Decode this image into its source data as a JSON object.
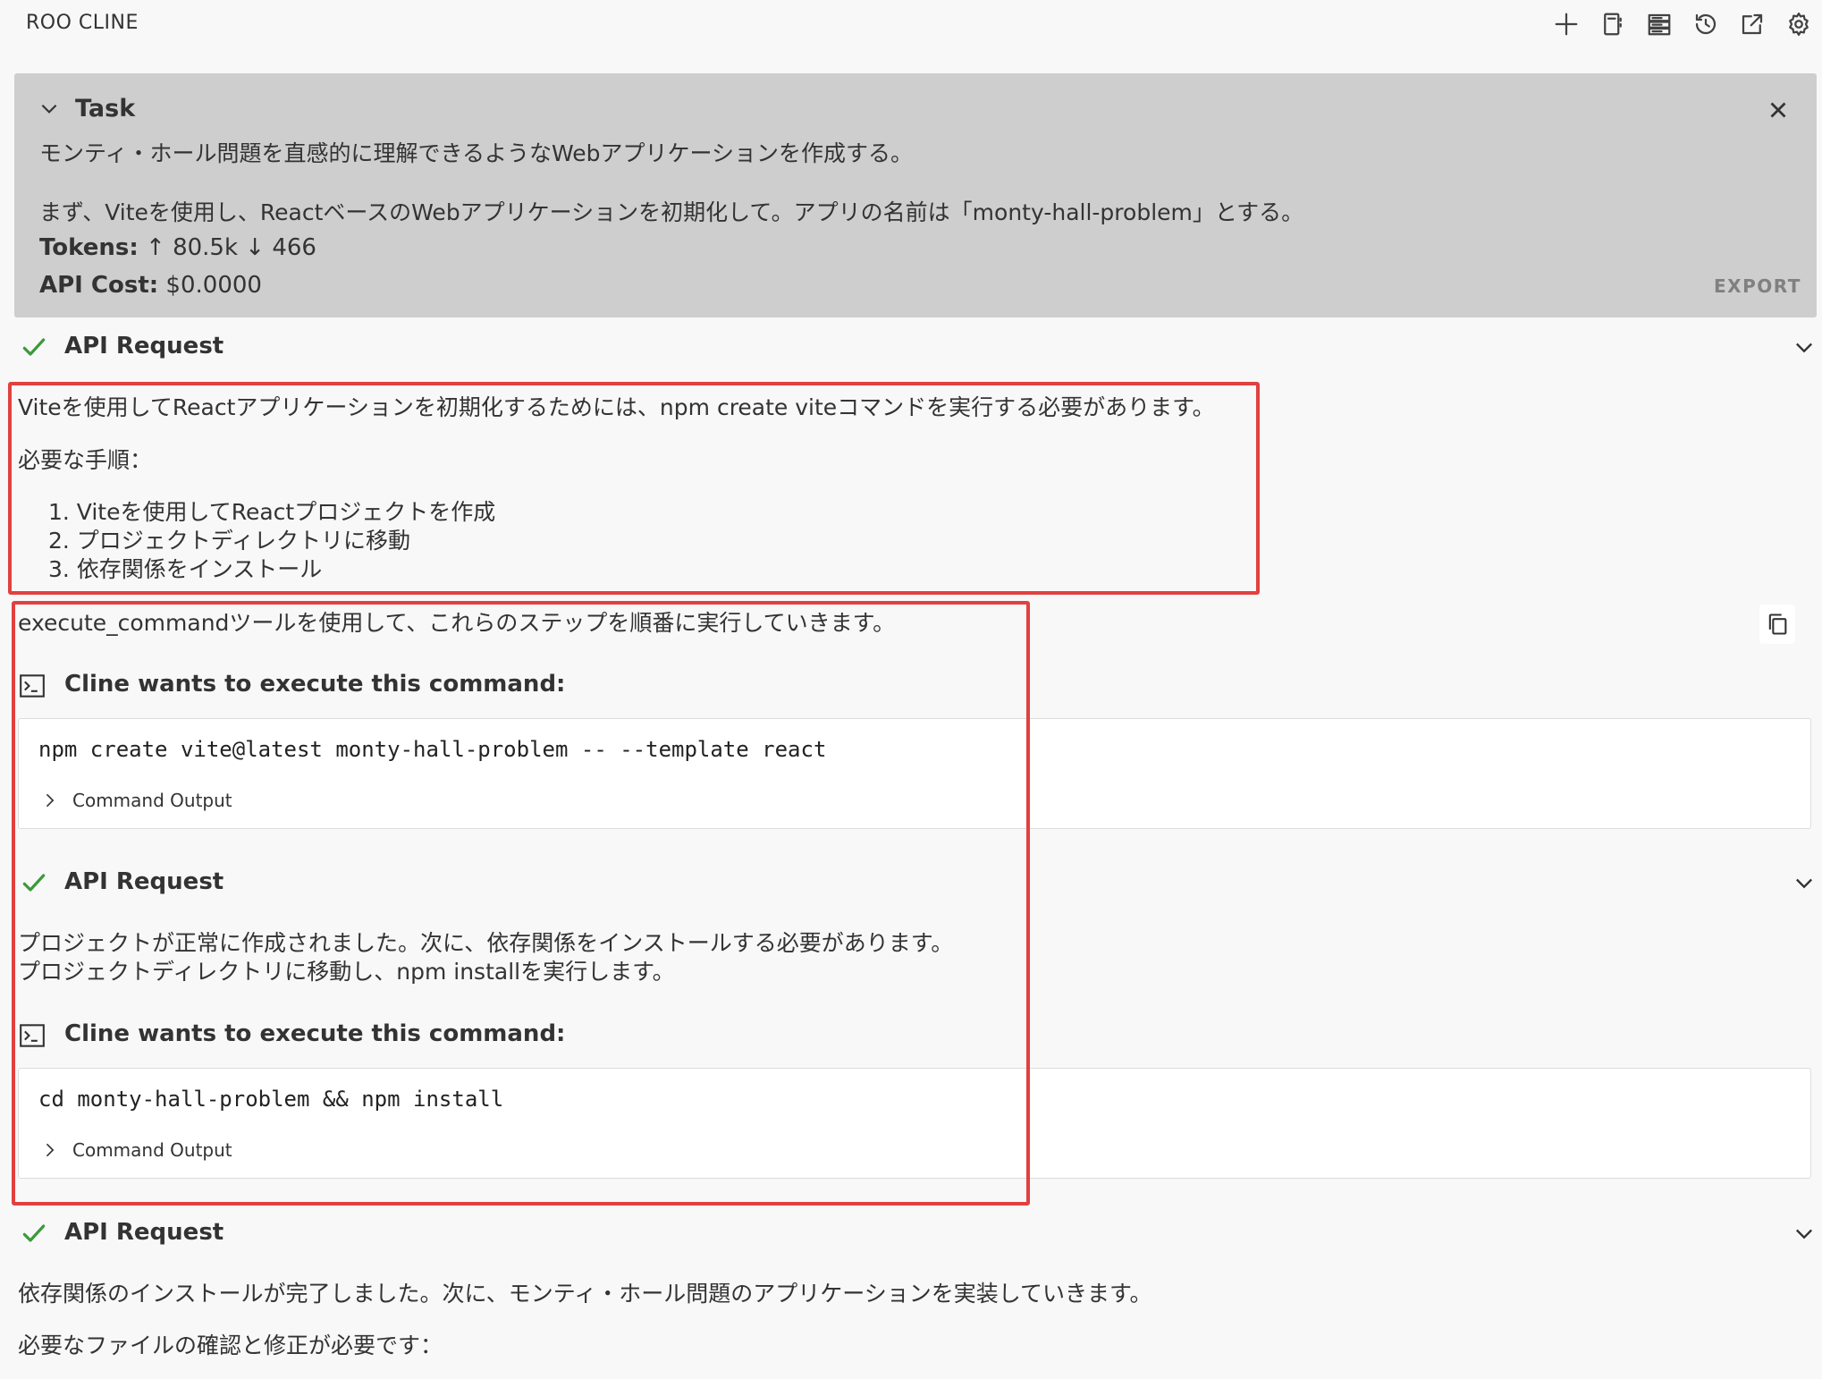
{
  "app": {
    "title": "ROO CLINE"
  },
  "toolbar": {
    "buttons": [
      {
        "name": "new-task",
        "icon": "plus-icon"
      },
      {
        "name": "prompts",
        "icon": "notebook-icon"
      },
      {
        "name": "mcp-servers",
        "icon": "server-icon"
      },
      {
        "name": "history",
        "icon": "history-icon"
      },
      {
        "name": "open-in-tab",
        "icon": "link-external-icon"
      },
      {
        "name": "settings",
        "icon": "gear-icon"
      }
    ]
  },
  "task": {
    "label": "Task",
    "text_line1": "モンティ・ホール問題を直感的に理解できるようなWebアプリケーションを作成する。",
    "text_line2": "まず、Viteを使用し、ReactベースのWebアプリケーションを初期化して。アプリの名前は「monty-hall-problem」とする。",
    "tokens_label": "Tokens:",
    "tokens_up": "↑ 80.5k",
    "tokens_down": "↓ 466",
    "cost_label": "API Cost:",
    "cost_value": "$0.0000",
    "export_label": "EXPORT"
  },
  "messages": {
    "api_label": "API Request",
    "block1": {
      "intro": "Viteを使用してReactアプリケーションを初期化するためには、npm create viteコマンドを実行する必要があります。",
      "steps_title": "必要な手順：",
      "steps": [
        "1. Viteを使用してReactプロジェクトを作成",
        "2. プロジェクトディレクトリに移動",
        "3. 依存関係をインストール"
      ],
      "outro": "execute_commandツールを使用して、これらのステップを順番に実行していきます。"
    },
    "command_title": "Cline wants to execute this command:",
    "command_output_label": "Command Output",
    "command1": "npm create vite@latest monty-hall-problem -- --template react",
    "block2": {
      "line1": "プロジェクトが正常に作成されました。次に、依存関係をインストールする必要があります。",
      "line2": "プロジェクトディレクトリに移動し、npm installを実行します。"
    },
    "command2": "cd monty-hall-problem && npm install",
    "block3": {
      "line1": "依存関係のインストールが完了しました。次に、モンティ・ホール問題のアプリケーションを実装していきます。",
      "line2": "必要なファイルの確認と修正が必要です："
    }
  },
  "colors": {
    "background": "#f8f8f8",
    "task_panel": "#cecece",
    "success": "#3a9a3a",
    "annotation": "#e0413f"
  }
}
